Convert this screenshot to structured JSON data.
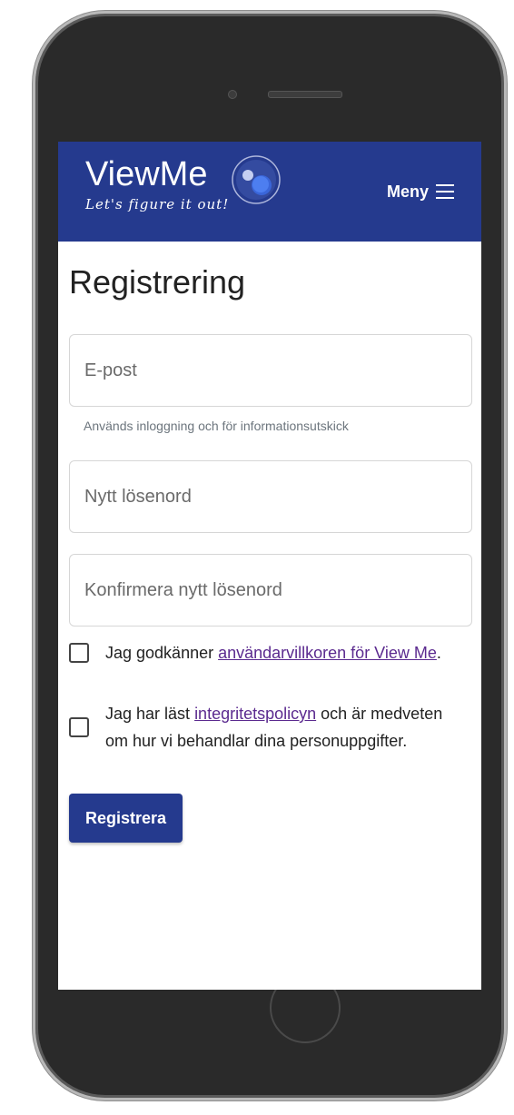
{
  "header": {
    "brand_name": "ViewMe",
    "tagline": "Let's figure it out!",
    "menu_label": "Meny",
    "colors": {
      "brand": "#253a8e"
    }
  },
  "main": {
    "title": "Registrering",
    "email_placeholder": "E-post",
    "email_help": "Används inloggning och för informationsutskick",
    "new_password_placeholder": "Nytt lösenord",
    "confirm_password_placeholder": "Konfirmera nytt lösenord",
    "terms": {
      "prefix": "Jag godkänner ",
      "link": "användarvillkoren för View Me",
      "suffix": "."
    },
    "privacy": {
      "prefix": "Jag har läst ",
      "link": "integritetspolicyn",
      "suffix": " och är medveten om hur vi behandlar dina personuppgifter."
    },
    "submit_label": "Registrera"
  },
  "icons": {
    "menu": "hamburger-icon",
    "logo": "viewme-logo-icon"
  }
}
